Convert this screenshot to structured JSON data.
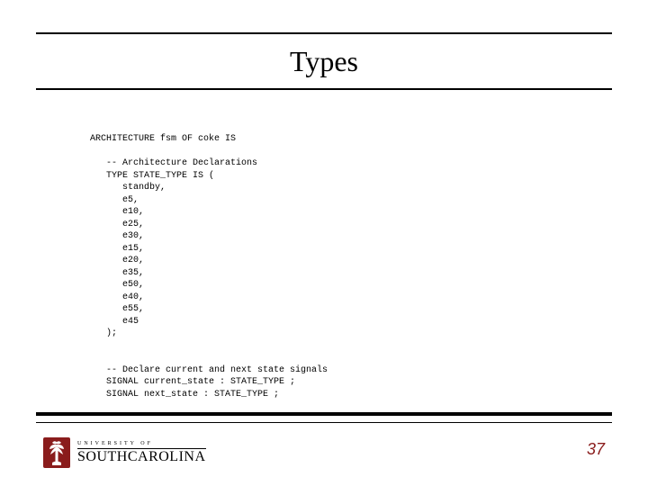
{
  "title": "Types",
  "code": "ARCHITECTURE fsm OF coke IS\n\n   -- Architecture Declarations\n   TYPE STATE_TYPE IS (\n      standby,\n      e5,\n      e10,\n      e25,\n      e30,\n      e15,\n      e20,\n      e35,\n      e50,\n      e40,\n      e55,\n      e45\n   );\n\n\n   -- Declare current and next state signals\n   SIGNAL current_state : STATE_TYPE ;\n   SIGNAL next_state : STATE_TYPE ;",
  "logo": {
    "university_label": "UNIVERSITY OF",
    "name": "SOUTHCAROLINA"
  },
  "page_number": "37",
  "colors": {
    "accent": "#8a1c1c"
  }
}
